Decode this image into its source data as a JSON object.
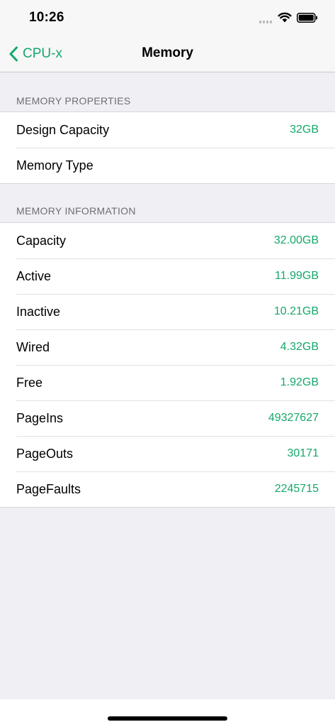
{
  "status_bar": {
    "time": "10:26"
  },
  "nav": {
    "back_label": "CPU-x",
    "title": "Memory"
  },
  "sections": [
    {
      "header": "MEMORY PROPERTIES",
      "rows": [
        {
          "label": "Design Capacity",
          "value": "32GB"
        },
        {
          "label": "Memory Type",
          "value": ""
        }
      ]
    },
    {
      "header": "MEMORY INFORMATION",
      "rows": [
        {
          "label": "Capacity",
          "value": "32.00GB"
        },
        {
          "label": "Active",
          "value": "11.99GB"
        },
        {
          "label": "Inactive",
          "value": "10.21GB"
        },
        {
          "label": "Wired",
          "value": "4.32GB"
        },
        {
          "label": "Free",
          "value": "1.92GB"
        },
        {
          "label": "PageIns",
          "value": "49327627"
        },
        {
          "label": "PageOuts",
          "value": "30171"
        },
        {
          "label": "PageFaults",
          "value": "2245715"
        }
      ]
    }
  ],
  "colors": {
    "accent": "#14a86a",
    "background": "#efeff4",
    "section_header": "#6d6d72"
  },
  "icons": {
    "back": "chevron-left-icon",
    "signal": "signal-icon",
    "wifi": "wifi-icon",
    "battery": "battery-icon"
  }
}
